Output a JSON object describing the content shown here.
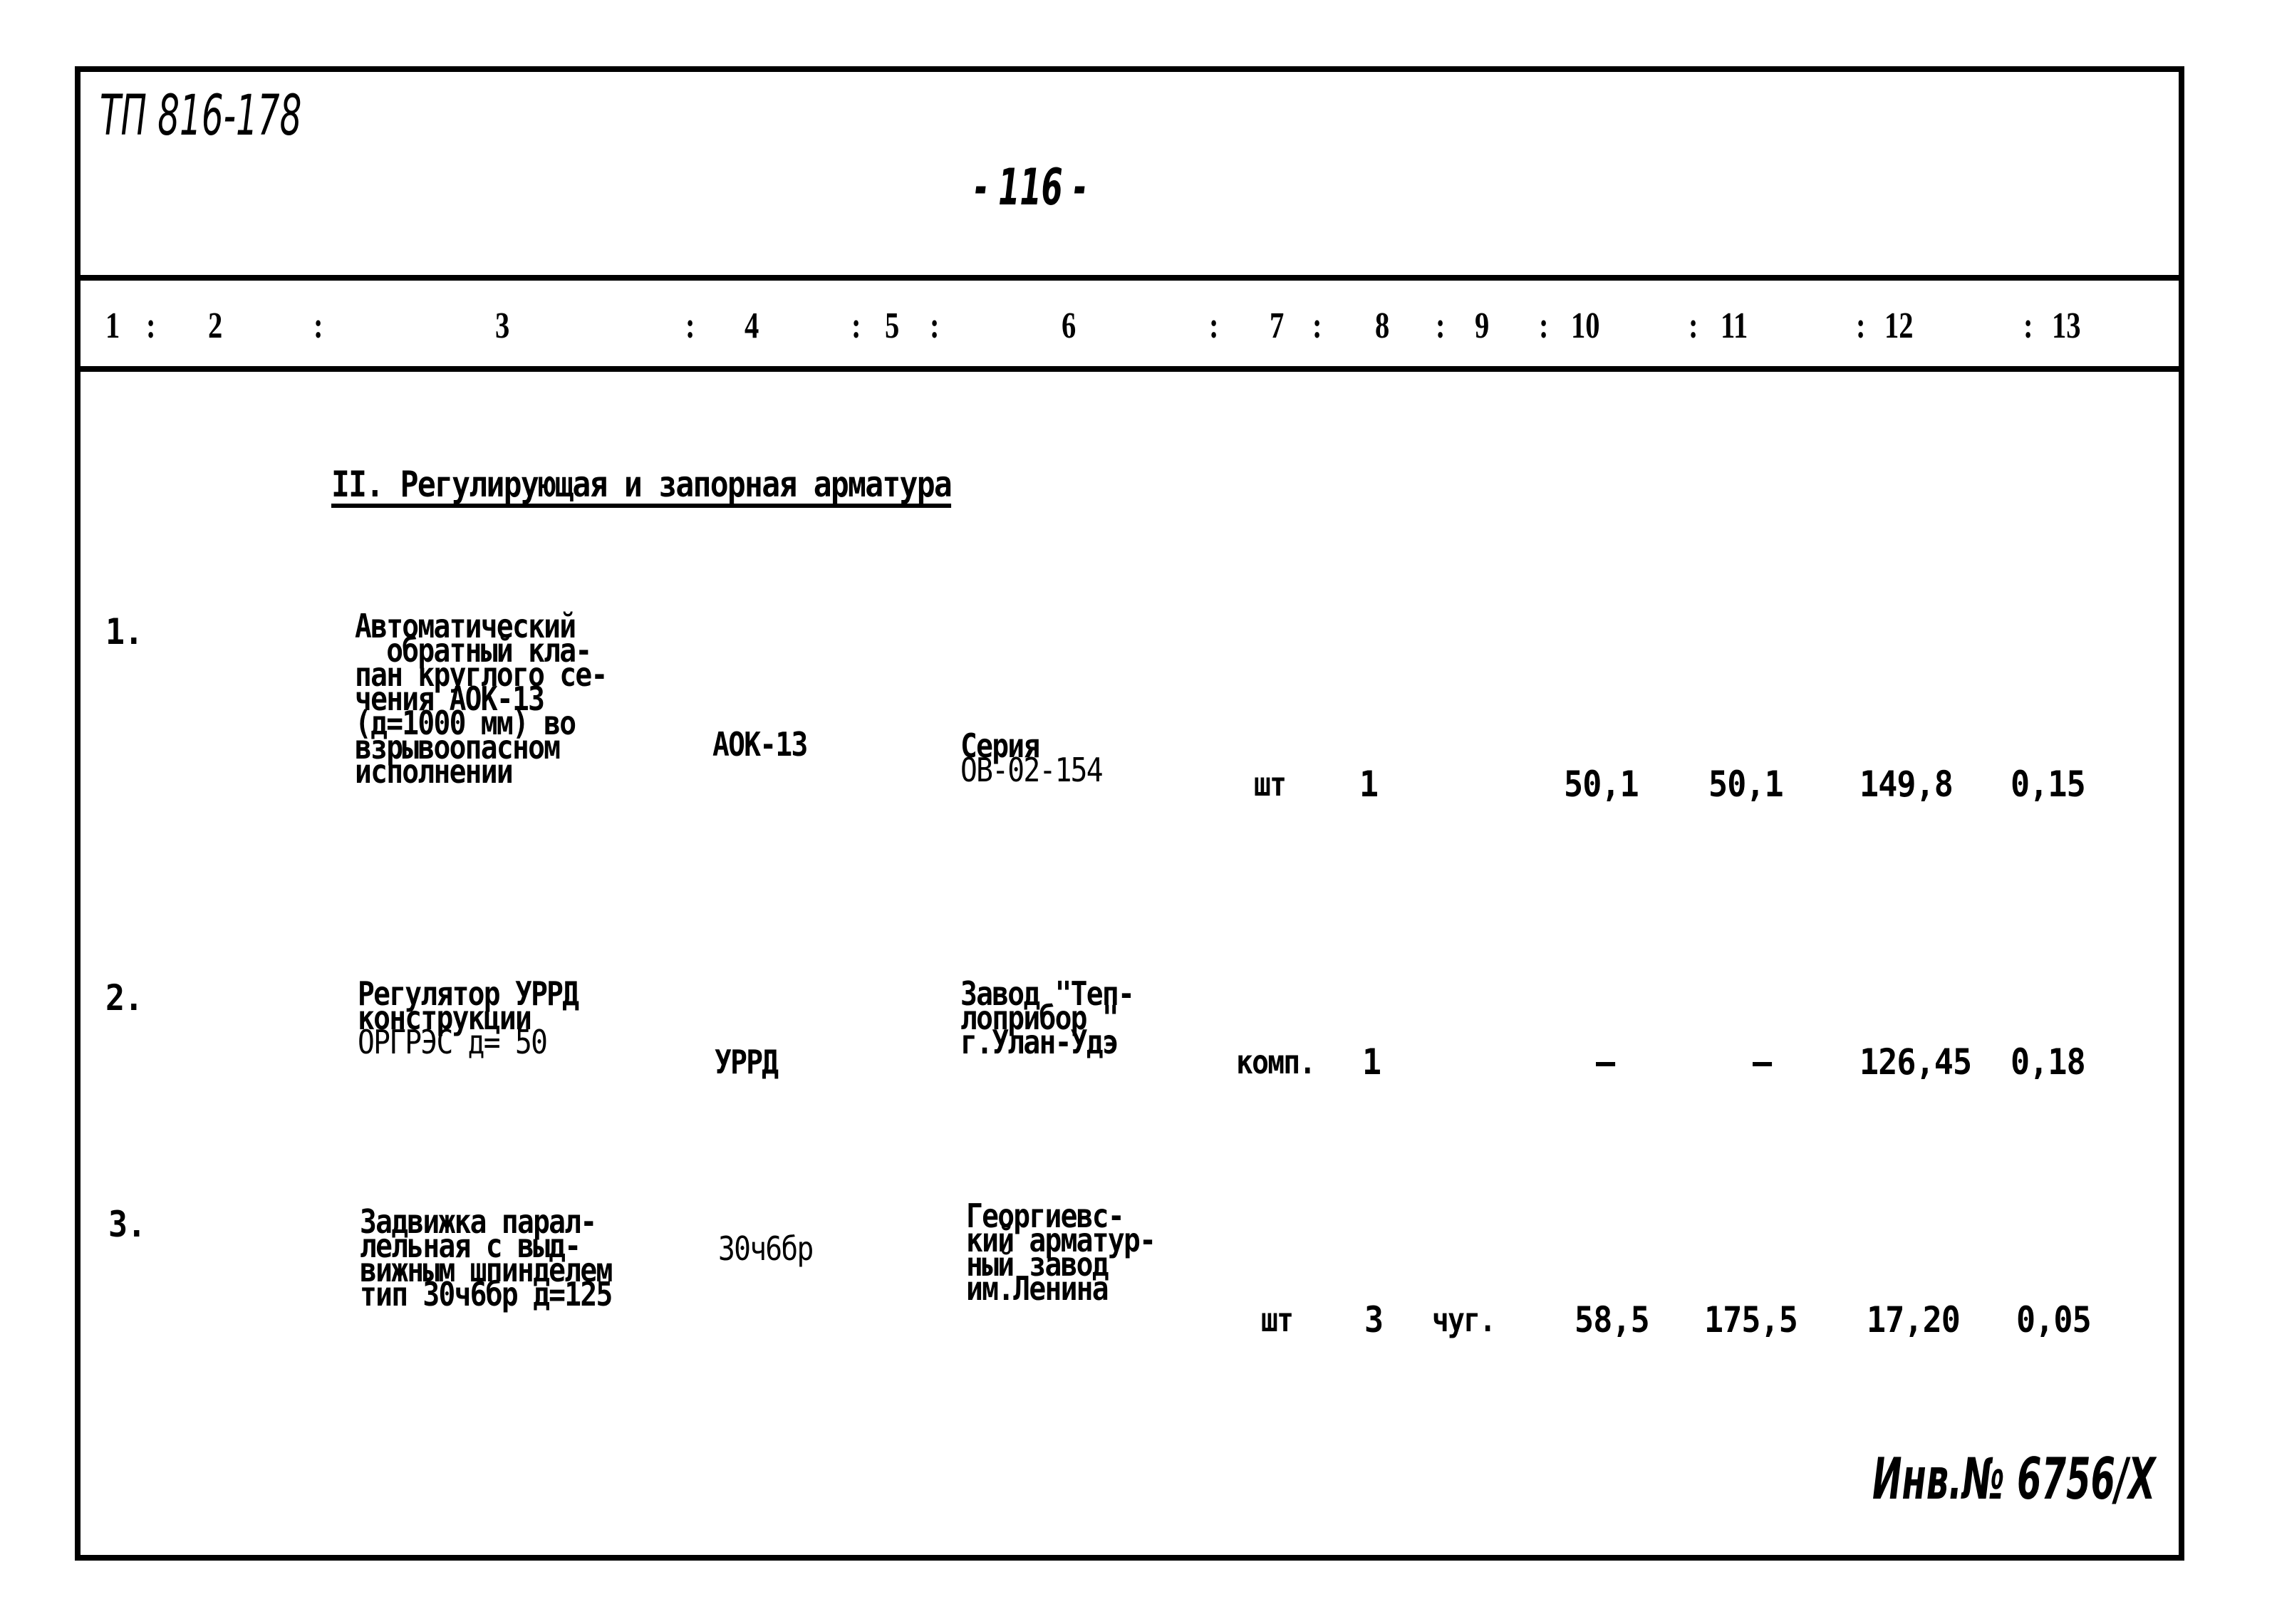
{
  "document": {
    "code": "ТП 816-178",
    "page_number": "- 116 -",
    "inventory_stamp": "Инв.№ 6756/X"
  },
  "column_numbers": {
    "c1": "1",
    "c2": "2",
    "c3": "3",
    "c4": "4",
    "c5": "5",
    "c6": "6",
    "c7": "7",
    "c8": "8",
    "c9": "9",
    "c10": "10",
    "c11": "11",
    "c12": "12",
    "c13": "13",
    "separator": ":"
  },
  "section": {
    "heading": "II. Регулирующая и запорная арматура"
  },
  "rows": [
    {
      "num": "1.",
      "description_lines": [
        "Автоматический",
        "  обратный кла-",
        "пан круглого се-",
        "чения АОК-13",
        "(д=1000 мм) во",
        "взрывоопасном",
        "исполнении"
      ],
      "type": "АОК-13",
      "manufacturer_lines": [
        "Серия",
        "ОВ-02-154"
      ],
      "unit": "шт",
      "quantity": "1",
      "material": "",
      "mass_unit": "50,1",
      "mass_total": "50,1",
      "col12": "149,8",
      "col13": "0,15"
    },
    {
      "num": "2.",
      "description_lines": [
        "Регулятор УРРД",
        "конструкции",
        "ОРГРЭС д= 50"
      ],
      "type": "УРРД",
      "manufacturer_lines": [
        "Завод \"Теп-",
        "лоприбор \"",
        "г.Улан-Удэ"
      ],
      "unit": "комп.",
      "quantity": "1",
      "material": "",
      "mass_unit": "–",
      "mass_total": "–",
      "col12": "126,45",
      "col13": "0,18"
    },
    {
      "num": "3.",
      "description_lines": [
        "Задвижка парал-",
        "лельная с выд-",
        "вижным шпинделем",
        "тип 30ч6бр д=125"
      ],
      "type": "30ч6бр",
      "manufacturer_lines": [
        "Георгиевс-",
        "кий арматур-",
        "ный завод",
        "им.Ленина"
      ],
      "unit": "шт",
      "quantity": "3",
      "material": "чуг.",
      "mass_unit": "58,5",
      "mass_total": "175,5",
      "col12": "17,20",
      "col13": "0,05"
    }
  ]
}
